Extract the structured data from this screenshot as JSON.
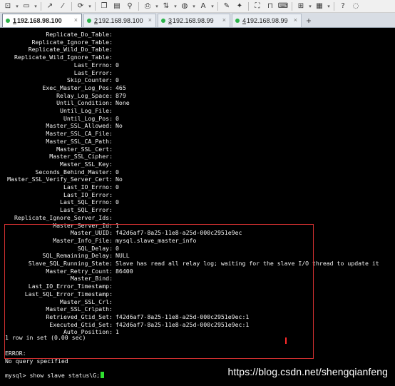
{
  "tabs": [
    {
      "num": "1",
      "label": "192.168.98.100",
      "active": true
    },
    {
      "num": "2",
      "label": "192.168.98.100",
      "active": false
    },
    {
      "num": "3",
      "label": "192.168.98.99",
      "active": false
    },
    {
      "num": "4",
      "label": "192.168.98.99",
      "active": false
    }
  ],
  "tab_close": "×",
  "tab_add": "+",
  "status_rows": [
    {
      "key": "Replicate_Do_Table:",
      "value": ""
    },
    {
      "key": "Replicate_Ignore_Table:",
      "value": ""
    },
    {
      "key": "Replicate_Wild_Do_Table:",
      "value": ""
    },
    {
      "key": "Replicate_Wild_Ignore_Table:",
      "value": ""
    },
    {
      "key": "Last_Errno:",
      "value": "0"
    },
    {
      "key": "Last_Error:",
      "value": ""
    },
    {
      "key": "Skip_Counter:",
      "value": "0"
    },
    {
      "key": "Exec_Master_Log_Pos:",
      "value": "465"
    },
    {
      "key": "Relay_Log_Space:",
      "value": "879"
    },
    {
      "key": "Until_Condition:",
      "value": "None"
    },
    {
      "key": "Until_Log_File:",
      "value": ""
    },
    {
      "key": "Until_Log_Pos:",
      "value": "0"
    },
    {
      "key": "Master_SSL_Allowed:",
      "value": "No"
    },
    {
      "key": "Master_SSL_CA_File:",
      "value": ""
    },
    {
      "key": "Master_SSL_CA_Path:",
      "value": ""
    },
    {
      "key": "Master_SSL_Cert:",
      "value": ""
    },
    {
      "key": "Master_SSL_Cipher:",
      "value": ""
    },
    {
      "key": "Master_SSL_Key:",
      "value": ""
    },
    {
      "key": "Seconds_Behind_Master:",
      "value": "0"
    },
    {
      "key": "Master_SSL_Verify_Server_Cert:",
      "value": "No"
    },
    {
      "key": "Last_IO_Errno:",
      "value": "0"
    },
    {
      "key": "Last_IO_Error:",
      "value": ""
    },
    {
      "key": "Last_SQL_Errno:",
      "value": "0"
    },
    {
      "key": "Last_SQL_Error:",
      "value": ""
    },
    {
      "key": "Replicate_Ignore_Server_Ids:",
      "value": ""
    },
    {
      "key": "Master_Server_Id:",
      "value": "1"
    },
    {
      "key": "Master_UUID:",
      "value": "f42d6af7-8a25-11e8-a25d-000c2951e9ec"
    },
    {
      "key": "Master_Info_File:",
      "value": "mysql.slave_master_info"
    },
    {
      "key": "SQL_Delay:",
      "value": "0"
    },
    {
      "key": "SQL_Remaining_Delay:",
      "value": "NULL"
    },
    {
      "key": "Slave_SQL_Running_State:",
      "value": "Slave has read all relay log; waiting for the slave I/O thread to update it"
    },
    {
      "key": "Master_Retry_Count:",
      "value": "86400"
    },
    {
      "key": "Master_Bind:",
      "value": ""
    },
    {
      "key": "Last_IO_Error_Timestamp:",
      "value": ""
    },
    {
      "key": "Last_SQL_Error_Timestamp:",
      "value": ""
    },
    {
      "key": "Master_SSL_Crl:",
      "value": ""
    },
    {
      "key": "Master_SSL_Crlpath:",
      "value": ""
    },
    {
      "key": "Retrieved_Gtid_Set:",
      "value": "f42d6af7-8a25-11e8-a25d-000c2951e9ec:1"
    },
    {
      "key": "Executed_Gtid_Set:",
      "value": "f42d6af7-8a25-11e8-a25d-000c2951e9ec:1"
    },
    {
      "key": "Auto_Position:",
      "value": "1"
    }
  ],
  "summary": "1 row in set (0.00 sec)",
  "error_label": "ERROR:",
  "error_message": "No query specified",
  "prompt": "mysql> show slave status\\G;",
  "watermark": "https://blog.csdn.net/shengqianfeng"
}
